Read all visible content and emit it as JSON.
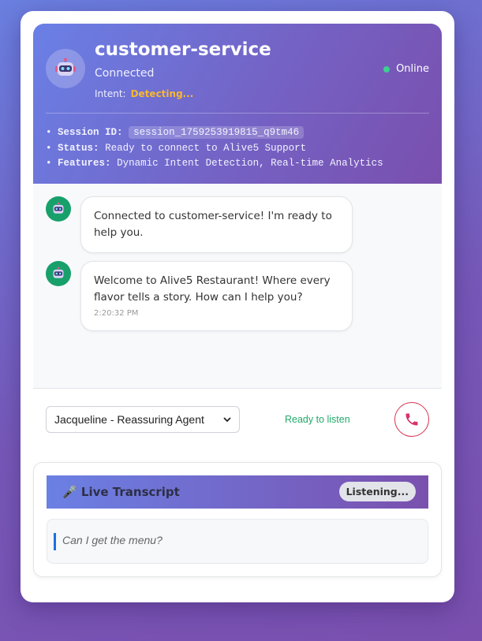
{
  "header": {
    "title": "customer-service",
    "subtitle": "Connected",
    "intent_label": "Intent:",
    "intent_value": "Detecting...",
    "status": "Online",
    "colors": {
      "online_dot": "#3ccf91",
      "intent_value": "#f7b733"
    }
  },
  "session": {
    "bullet": "•",
    "session_id_label": "Session ID:",
    "session_id_value": "session_1759253919815_q9tm46",
    "status_label": "Status:",
    "status_value": "Ready to connect to Alive5 Support",
    "features_label": "Features:",
    "features_value": "Dynamic Intent Detection, Real-time Analytics"
  },
  "messages": [
    {
      "sender": "bot",
      "text": "Connected to customer-service! I'm ready to help you.",
      "time": ""
    },
    {
      "sender": "bot",
      "text": "Welcome to Alive5 Restaurant! Where every flavor tells a story. How can I help you?",
      "time": "2:20:32 PM"
    }
  ],
  "controls": {
    "voice_selected": "Jacqueline - Reassuring Agent",
    "ready_text": "Ready to listen",
    "call_icon": "phone-icon"
  },
  "transcript": {
    "title": "Live Transcript",
    "title_icon": "microphone-icon",
    "badge": "Listening...",
    "text": "Can I get the menu?"
  }
}
